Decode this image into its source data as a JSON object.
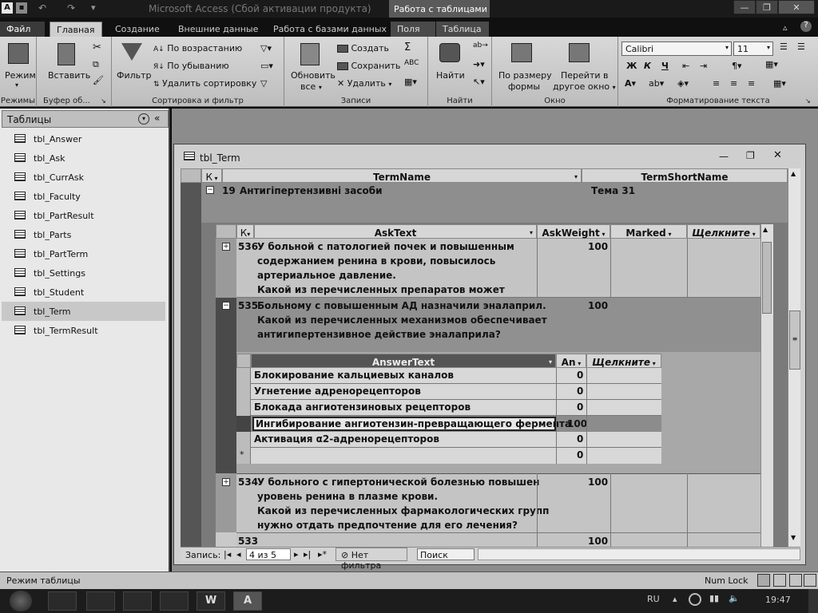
{
  "titlebar": {
    "app_icon": "A",
    "title": "Microsoft Access (Сбой активации продукта)",
    "context_title": "Работа с таблицами"
  },
  "tabs": [
    "Файл",
    "Главная",
    "Создание",
    "Внешние данные",
    "Работа с базами данных",
    "Поля",
    "Таблица"
  ],
  "ribbon": {
    "mode": {
      "label": "Режим",
      "group": "Режимы"
    },
    "clipboard": {
      "paste": "Вставить",
      "group": "Буфер об..."
    },
    "sort": {
      "filter": "Фильтр",
      "asc": "По возрастанию",
      "desc": "По убыванию",
      "clear": "Удалить сортировку",
      "group": "Сортировка и фильтр"
    },
    "records": {
      "refresh": "Обновить",
      "refresh2": "все",
      "create": "Создать",
      "save": "Сохранить",
      "delete": "Удалить",
      "group": "Записи"
    },
    "find": {
      "label": "Найти",
      "group": "Найти"
    },
    "window": {
      "fit": "По размеру",
      "fit2": "формы",
      "switch": "Перейти в",
      "switch2": "другое окно",
      "group": "Окно"
    },
    "format": {
      "font": "Calibri",
      "size": "11",
      "bold": "Ж",
      "italic": "К",
      "underline": "Ч",
      "group": "Форматирование текста"
    }
  },
  "nav": {
    "header": "Таблицы",
    "items": [
      "tbl_Answer",
      "tbl_Ask",
      "tbl_CurrAsk",
      "tbl_Faculty",
      "tbl_PartResult",
      "tbl_Parts",
      "tbl_PartTerm",
      "tbl_Settings",
      "tbl_Student",
      "tbl_Term",
      "tbl_TermResult"
    ],
    "selected": "tbl_Term"
  },
  "doc": {
    "title": "tbl_Term",
    "headers": {
      "k": "К",
      "termname": "TermName",
      "termshort": "TermShortName"
    },
    "term_row": {
      "id": "19",
      "name": "Антигіпертензивні засоби",
      "short": "Тема 31"
    },
    "ask_headers": {
      "k": "К",
      "asktext": "AskText",
      "askweight": "AskWeight",
      "marked": "Marked",
      "click": "Щелкните"
    },
    "asks": [
      {
        "id": "536",
        "lines": [
          "У больной с патологией почек и повышенным",
          "содержанием ренина в крови, повысилось",
          "артериальное давление.",
          "Какой из перечисленных препаратов может"
        ],
        "weight": "100"
      },
      {
        "id": "535",
        "lines": [
          "Больному с повышенным АД назначили эналаприл.",
          "Какой из перечисленных механизмов обеспечивает",
          "антигипертензивное действие эналаприла?"
        ],
        "weight": "100"
      },
      {
        "id": "534",
        "lines": [
          "У больного с гипертонической болезнью повышен",
          "уровень ренина в плазме крови.",
          "Какой из перечисленных фармакологических групп",
          "нужно отдать предпочтение для его лечения?"
        ],
        "weight": "100"
      }
    ],
    "answer_headers": {
      "text": "AnswerText",
      "an": "An",
      "click": "Щелкните"
    },
    "answers": [
      {
        "text": "Блокирование кальциевых каналов",
        "value": "0"
      },
      {
        "text": "Угнетение адренорецепторов",
        "value": "0"
      },
      {
        "text": "Блокада ангиотензиновых рецепторов",
        "value": "0"
      },
      {
        "text": "Ингибирование ангиотензин-превращающего фермента",
        "value": "100"
      },
      {
        "text": "Активация α2-адренорецепторов",
        "value": "0"
      }
    ],
    "new_row": {
      "marker": "*",
      "value": "0"
    },
    "partial_row": {
      "id": "533",
      "weight": "100"
    }
  },
  "recbar": {
    "label": "Запись:",
    "pos": "4 из 5",
    "filter": "Нет фильтра",
    "search": "Поиск"
  },
  "status": {
    "mode": "Режим таблицы",
    "numlock": "Num Lock"
  },
  "taskbar": {
    "lang": "RU",
    "time": "19:47"
  }
}
